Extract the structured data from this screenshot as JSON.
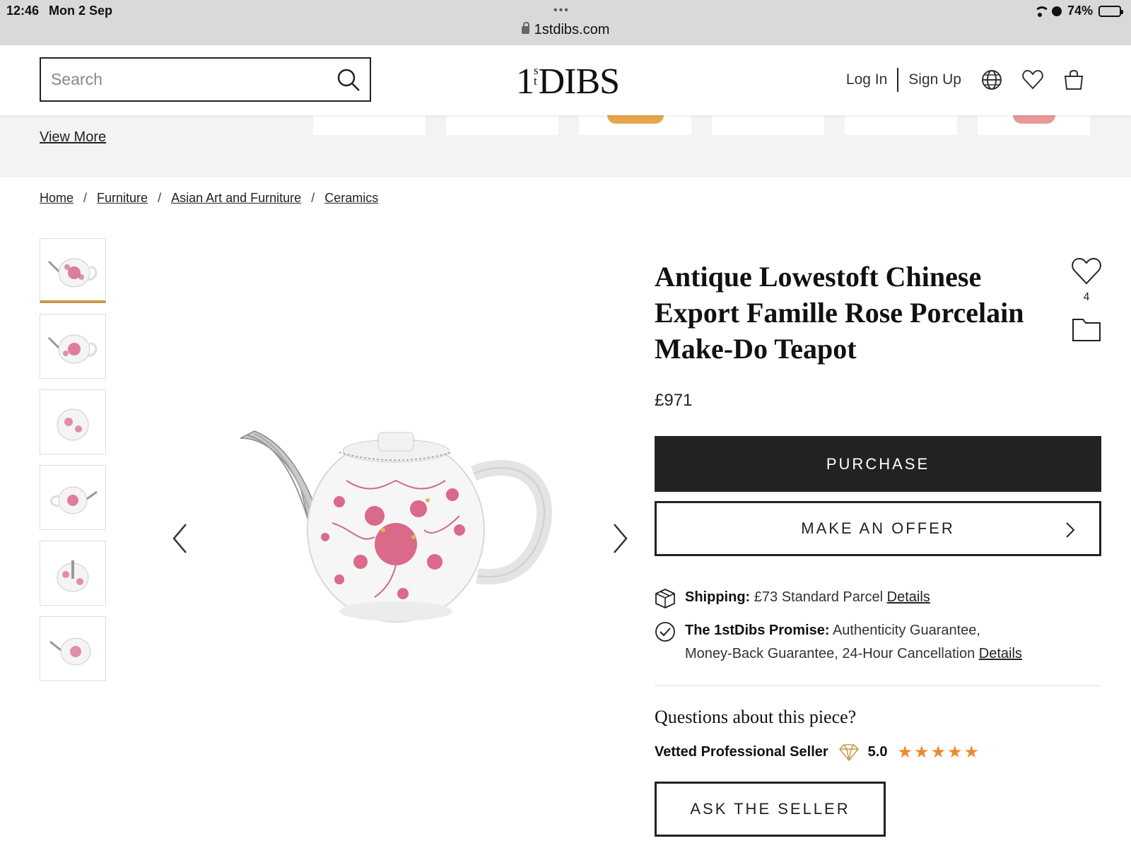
{
  "status_bar": {
    "time": "12:46",
    "date": "Mon 2 Sep",
    "url": "1stdibs.com",
    "battery": "74%",
    "battery_level": 0.74
  },
  "header": {
    "search_placeholder": "Search",
    "logo_main": "DIBS",
    "logo_num": "1",
    "logo_sup_s": "s",
    "logo_sup_t": "t",
    "login": "Log In",
    "signup": "Sign Up"
  },
  "strip": {
    "view_more": "View More"
  },
  "breadcrumb": [
    "Home",
    "Furniture",
    "Asian Art and Furniture",
    "Ceramics"
  ],
  "product": {
    "title": "Antique Lowestoft Chinese Export Famille Rose Porcelain Make-Do Teapot",
    "favorite_count": "4",
    "price": "£971",
    "purchase_label": "PURCHASE",
    "offer_label": "MAKE AN OFFER",
    "shipping_label": "Shipping:",
    "shipping_value": "£73 Standard Parcel",
    "shipping_link": "Details",
    "promise_label": "The 1stDibs Promise:",
    "promise_value_1": "Authenticity Guarantee,",
    "promise_value_2": "Money-Back Guarantee, 24-Hour Cancellation",
    "promise_link": "Details",
    "questions": "Questions about this piece?",
    "seller_label": "Vetted Professional Seller",
    "rating": "5.0",
    "rating_stars": 5,
    "ask_label": "ASK THE SELLER"
  },
  "colors": {
    "accent": "#c69a4a",
    "stars": "#f0892c",
    "dark": "#222222",
    "strip_bg": "#f3f3f3"
  }
}
